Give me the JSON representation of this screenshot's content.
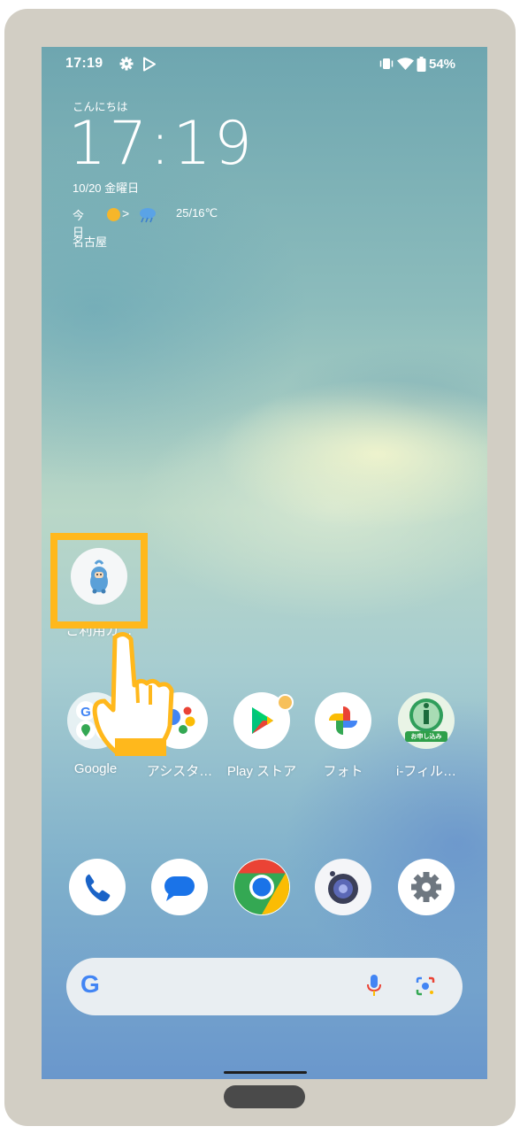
{
  "status_bar": {
    "time": "17:19",
    "battery": "54%"
  },
  "clock_widget": {
    "greeting": "こんにちは",
    "time": "17:19",
    "date": "10/20 金曜日",
    "weather_label": "今日",
    "temperature": "25/16℃",
    "location": "名古屋"
  },
  "folder_app": {
    "label": "ご利用ガ…"
  },
  "app_row": [
    {
      "name": "google-folder",
      "label": "Google"
    },
    {
      "name": "assistant",
      "label": "アシスタ…"
    },
    {
      "name": "play-store",
      "label": "Play ストア"
    },
    {
      "name": "photos",
      "label": "フォト"
    },
    {
      "name": "i-filter",
      "label": "i-フィル…",
      "badge": "お申し込み"
    }
  ],
  "dock": [
    "phone",
    "messages",
    "chrome",
    "camera",
    "settings"
  ],
  "search_bar": {
    "logo": "G"
  },
  "colors": {
    "highlight": "#ffb81c",
    "frame": "#d2cec4"
  }
}
